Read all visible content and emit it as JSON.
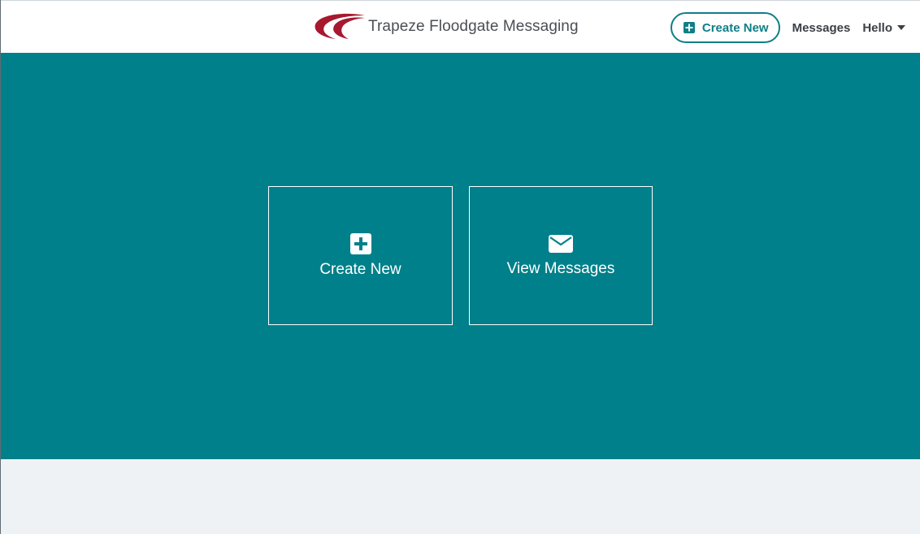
{
  "header": {
    "brand_name": "Trapeze Floodgate Messaging",
    "create_new_label": "Create New",
    "messages_label": "Messages",
    "user_greeting": "Hello"
  },
  "tiles": {
    "create_new_label": "Create New",
    "view_messages_label": "View Messages"
  },
  "colors": {
    "primary_teal": "#00808a",
    "brand_red": "#a6192e",
    "background": "#eff2f5"
  }
}
